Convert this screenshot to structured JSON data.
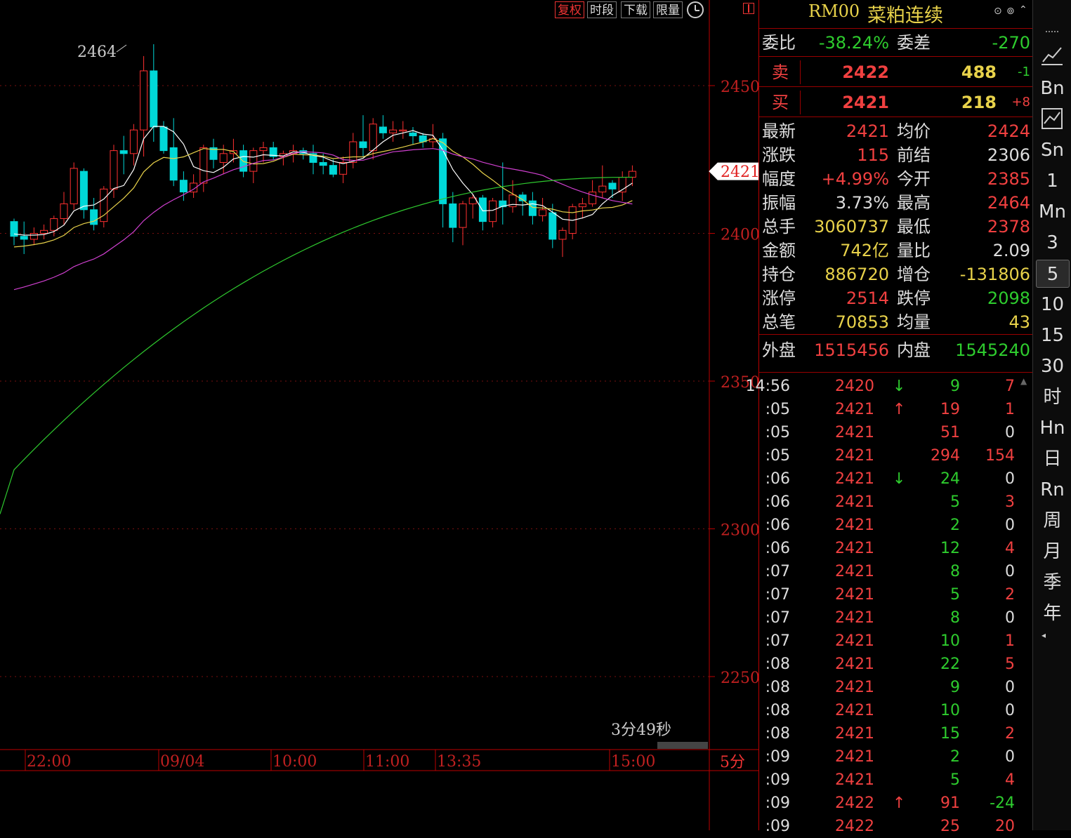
{
  "toolbar": {
    "fuquan": "复权",
    "shiduan": "时段",
    "xiazai": "下载",
    "xianliang": "限量"
  },
  "chart": {
    "high_label": "2464",
    "y_ticks": [
      "2450",
      "2400",
      "2350",
      "2300",
      "2250"
    ],
    "x_ticks": [
      "22:00",
      "09/04",
      "10:00",
      "11:00",
      "13:35",
      "15:00"
    ],
    "period_label": "5分",
    "countdown": "3分49秒",
    "last_price_tag": "2421"
  },
  "chart_data": {
    "type": "candlestick",
    "ohlc": [
      [
        2404,
        2405,
        2396,
        2399
      ],
      [
        2399,
        2404,
        2393,
        2398
      ],
      [
        2398,
        2402,
        2396,
        2400
      ],
      [
        2400,
        2403,
        2398,
        2401
      ],
      [
        2401,
        2406,
        2399,
        2405
      ],
      [
        2405,
        2414,
        2403,
        2410
      ],
      [
        2410,
        2424,
        2408,
        2422
      ],
      [
        2421,
        2422,
        2405,
        2408
      ],
      [
        2408,
        2412,
        2401,
        2403
      ],
      [
        2404,
        2416,
        2402,
        2415
      ],
      [
        2415,
        2430,
        2412,
        2428
      ],
      [
        2428,
        2433,
        2420,
        2427
      ],
      [
        2427,
        2437,
        2423,
        2435
      ],
      [
        2435,
        2460,
        2426,
        2455
      ],
      [
        2455,
        2464,
        2431,
        2436
      ],
      [
        2436,
        2438,
        2427,
        2428
      ],
      [
        2429,
        2439,
        2416,
        2418
      ],
      [
        2418,
        2421,
        2411,
        2414
      ],
      [
        2414,
        2420,
        2412,
        2417
      ],
      [
        2417,
        2430,
        2414,
        2429
      ],
      [
        2429,
        2432,
        2422,
        2425
      ],
      [
        2424,
        2430,
        2420,
        2427
      ],
      [
        2427,
        2432,
        2424,
        2428
      ],
      [
        2428,
        2430,
        2419,
        2421
      ],
      [
        2421,
        2429,
        2417,
        2428
      ],
      [
        2428,
        2431,
        2424,
        2429
      ],
      [
        2429,
        2431,
        2425,
        2426
      ],
      [
        2426,
        2428,
        2423,
        2427
      ],
      [
        2427,
        2430,
        2424,
        2428
      ],
      [
        2428,
        2429,
        2425,
        2427
      ],
      [
        2427,
        2430,
        2420,
        2424
      ],
      [
        2424,
        2427,
        2420,
        2423
      ],
      [
        2423,
        2425,
        2419,
        2420
      ],
      [
        2420,
        2426,
        2417,
        2424
      ],
      [
        2424,
        2434,
        2422,
        2431
      ],
      [
        2431,
        2440,
        2426,
        2429
      ],
      [
        2428,
        2439,
        2425,
        2437
      ],
      [
        2436,
        2440,
        2432,
        2434
      ],
      [
        2434,
        2438,
        2431,
        2435
      ],
      [
        2435,
        2438,
        2432,
        2435
      ],
      [
        2434,
        2436,
        2430,
        2433
      ],
      [
        2433,
        2434,
        2429,
        2431
      ],
      [
        2431,
        2437,
        2429,
        2432
      ],
      [
        2432,
        2434,
        2402,
        2410
      ],
      [
        2410,
        2414,
        2397,
        2402
      ],
      [
        2402,
        2411,
        2396,
        2410
      ],
      [
        2410,
        2413,
        2405,
        2412
      ],
      [
        2412,
        2413,
        2401,
        2404
      ],
      [
        2404,
        2412,
        2402,
        2411
      ],
      [
        2411,
        2424,
        2403,
        2409
      ],
      [
        2409,
        2418,
        2407,
        2413
      ],
      [
        2413,
        2414,
        2406,
        2411
      ],
      [
        2411,
        2414,
        2403,
        2406
      ],
      [
        2406,
        2412,
        2404,
        2408
      ],
      [
        2407,
        2410,
        2395,
        2398
      ],
      [
        2398,
        2402,
        2392,
        2401
      ],
      [
        2400,
        2410,
        2398,
        2409
      ],
      [
        2409,
        2412,
        2405,
        2410
      ],
      [
        2410,
        2418,
        2409,
        2414
      ],
      [
        2414,
        2423,
        2412,
        2416
      ],
      [
        2417,
        2418,
        2412,
        2415
      ],
      [
        2414,
        2421,
        2411,
        2419
      ],
      [
        2419,
        2423,
        2416,
        2421
      ]
    ],
    "ma_colors": {
      "ma5": "#ffffff",
      "ma10": "#e8d24a",
      "ma20": "#d040d0",
      "ma60": "#2ec82e"
    },
    "y_range": [
      2230,
      2470
    ]
  },
  "quote": {
    "symbol": "RM00",
    "name": "菜粕连续",
    "weibi_label": "委比",
    "weibi": "-38.24%",
    "weicha_label": "委差",
    "weicha": "-270",
    "sell_label": "卖",
    "sell_price": "2422",
    "sell_vol": "488",
    "sell_chg": "-1",
    "buy_label": "买",
    "buy_price": "2421",
    "buy_vol": "218",
    "buy_chg": "+8",
    "stats": [
      {
        "l1": "最新",
        "v1": "2421",
        "c1": "red",
        "l2": "均价",
        "v2": "2424",
        "c2": "red"
      },
      {
        "l1": "涨跌",
        "v1": "115",
        "c1": "red",
        "l2": "前结",
        "v2": "2306",
        "c2": "wht"
      },
      {
        "l1": "幅度",
        "v1": "+4.99%",
        "c1": "red",
        "l2": "今开",
        "v2": "2385",
        "c2": "red"
      },
      {
        "l1": "振幅",
        "v1": "3.73%",
        "c1": "wht",
        "l2": "最高",
        "v2": "2464",
        "c2": "red"
      },
      {
        "l1": "总手",
        "v1": "3060737",
        "c1": "yel",
        "l2": "最低",
        "v2": "2378",
        "c2": "red"
      },
      {
        "l1": "金额",
        "v1": "742亿",
        "c1": "yel",
        "l2": "量比",
        "v2": "2.09",
        "c2": "wht"
      },
      {
        "l1": "持仓",
        "v1": "886720",
        "c1": "yel",
        "l2": "增仓",
        "v2": "-131806",
        "c2": "yel"
      },
      {
        "l1": "涨停",
        "v1": "2514",
        "c1": "red",
        "l2": "跌停",
        "v2": "2098",
        "c2": "grn"
      },
      {
        "l1": "总笔",
        "v1": "70853",
        "c1": "yel",
        "l2": "均量",
        "v2": "43",
        "c2": "yel"
      }
    ],
    "waipan_label": "外盘",
    "waipan": "1515456",
    "neipan_label": "内盘",
    "neipan": "1545240"
  },
  "ticks": [
    {
      "t": "14:56",
      "p": "2420",
      "a": "↓",
      "ac": "grn",
      "v": "9",
      "vc": "grn",
      "o": "7",
      "oc": "red"
    },
    {
      "t": ":05",
      "p": "2421",
      "a": "↑",
      "ac": "red",
      "v": "19",
      "vc": "red",
      "o": "1",
      "oc": "red"
    },
    {
      "t": ":05",
      "p": "2421",
      "a": "",
      "ac": "red",
      "v": "51",
      "vc": "red",
      "o": "0",
      "oc": "wht"
    },
    {
      "t": ":05",
      "p": "2421",
      "a": "",
      "ac": "red",
      "v": "294",
      "vc": "red",
      "o": "154",
      "oc": "red"
    },
    {
      "t": ":06",
      "p": "2421",
      "a": "↓",
      "ac": "grn",
      "v": "24",
      "vc": "grn",
      "o": "0",
      "oc": "wht"
    },
    {
      "t": ":06",
      "p": "2421",
      "a": "",
      "ac": "red",
      "v": "5",
      "vc": "grn",
      "o": "3",
      "oc": "red"
    },
    {
      "t": ":06",
      "p": "2421",
      "a": "",
      "ac": "red",
      "v": "2",
      "vc": "grn",
      "o": "0",
      "oc": "wht"
    },
    {
      "t": ":06",
      "p": "2421",
      "a": "",
      "ac": "red",
      "v": "12",
      "vc": "grn",
      "o": "4",
      "oc": "red"
    },
    {
      "t": ":07",
      "p": "2421",
      "a": "",
      "ac": "red",
      "v": "8",
      "vc": "grn",
      "o": "0",
      "oc": "wht"
    },
    {
      "t": ":07",
      "p": "2421",
      "a": "",
      "ac": "red",
      "v": "5",
      "vc": "grn",
      "o": "2",
      "oc": "red"
    },
    {
      "t": ":07",
      "p": "2421",
      "a": "",
      "ac": "red",
      "v": "8",
      "vc": "grn",
      "o": "0",
      "oc": "wht"
    },
    {
      "t": ":07",
      "p": "2421",
      "a": "",
      "ac": "red",
      "v": "10",
      "vc": "grn",
      "o": "1",
      "oc": "red"
    },
    {
      "t": ":08",
      "p": "2421",
      "a": "",
      "ac": "red",
      "v": "22",
      "vc": "grn",
      "o": "5",
      "oc": "red"
    },
    {
      "t": ":08",
      "p": "2421",
      "a": "",
      "ac": "red",
      "v": "9",
      "vc": "grn",
      "o": "0",
      "oc": "wht"
    },
    {
      "t": ":08",
      "p": "2421",
      "a": "",
      "ac": "red",
      "v": "10",
      "vc": "grn",
      "o": "0",
      "oc": "wht"
    },
    {
      "t": ":08",
      "p": "2421",
      "a": "",
      "ac": "red",
      "v": "15",
      "vc": "grn",
      "o": "2",
      "oc": "red"
    },
    {
      "t": ":09",
      "p": "2421",
      "a": "",
      "ac": "red",
      "v": "2",
      "vc": "grn",
      "o": "0",
      "oc": "wht"
    },
    {
      "t": ":09",
      "p": "2421",
      "a": "",
      "ac": "red",
      "v": "5",
      "vc": "grn",
      "o": "4",
      "oc": "red"
    },
    {
      "t": ":09",
      "p": "2422",
      "a": "↑",
      "ac": "red",
      "v": "91",
      "vc": "red",
      "o": "-24",
      "oc": "grn"
    },
    {
      "t": ":09",
      "p": "2422",
      "a": "",
      "ac": "red",
      "v": "25",
      "vc": "red",
      "o": "20",
      "oc": "red"
    }
  ],
  "sidebar": [
    "Bn",
    "Sn",
    "1",
    "Mn",
    "3",
    "5",
    "10",
    "15",
    "30",
    "时",
    "Hn",
    "日",
    "Rn",
    "周",
    "月",
    "季",
    "年"
  ],
  "sidebar_selected": "5"
}
